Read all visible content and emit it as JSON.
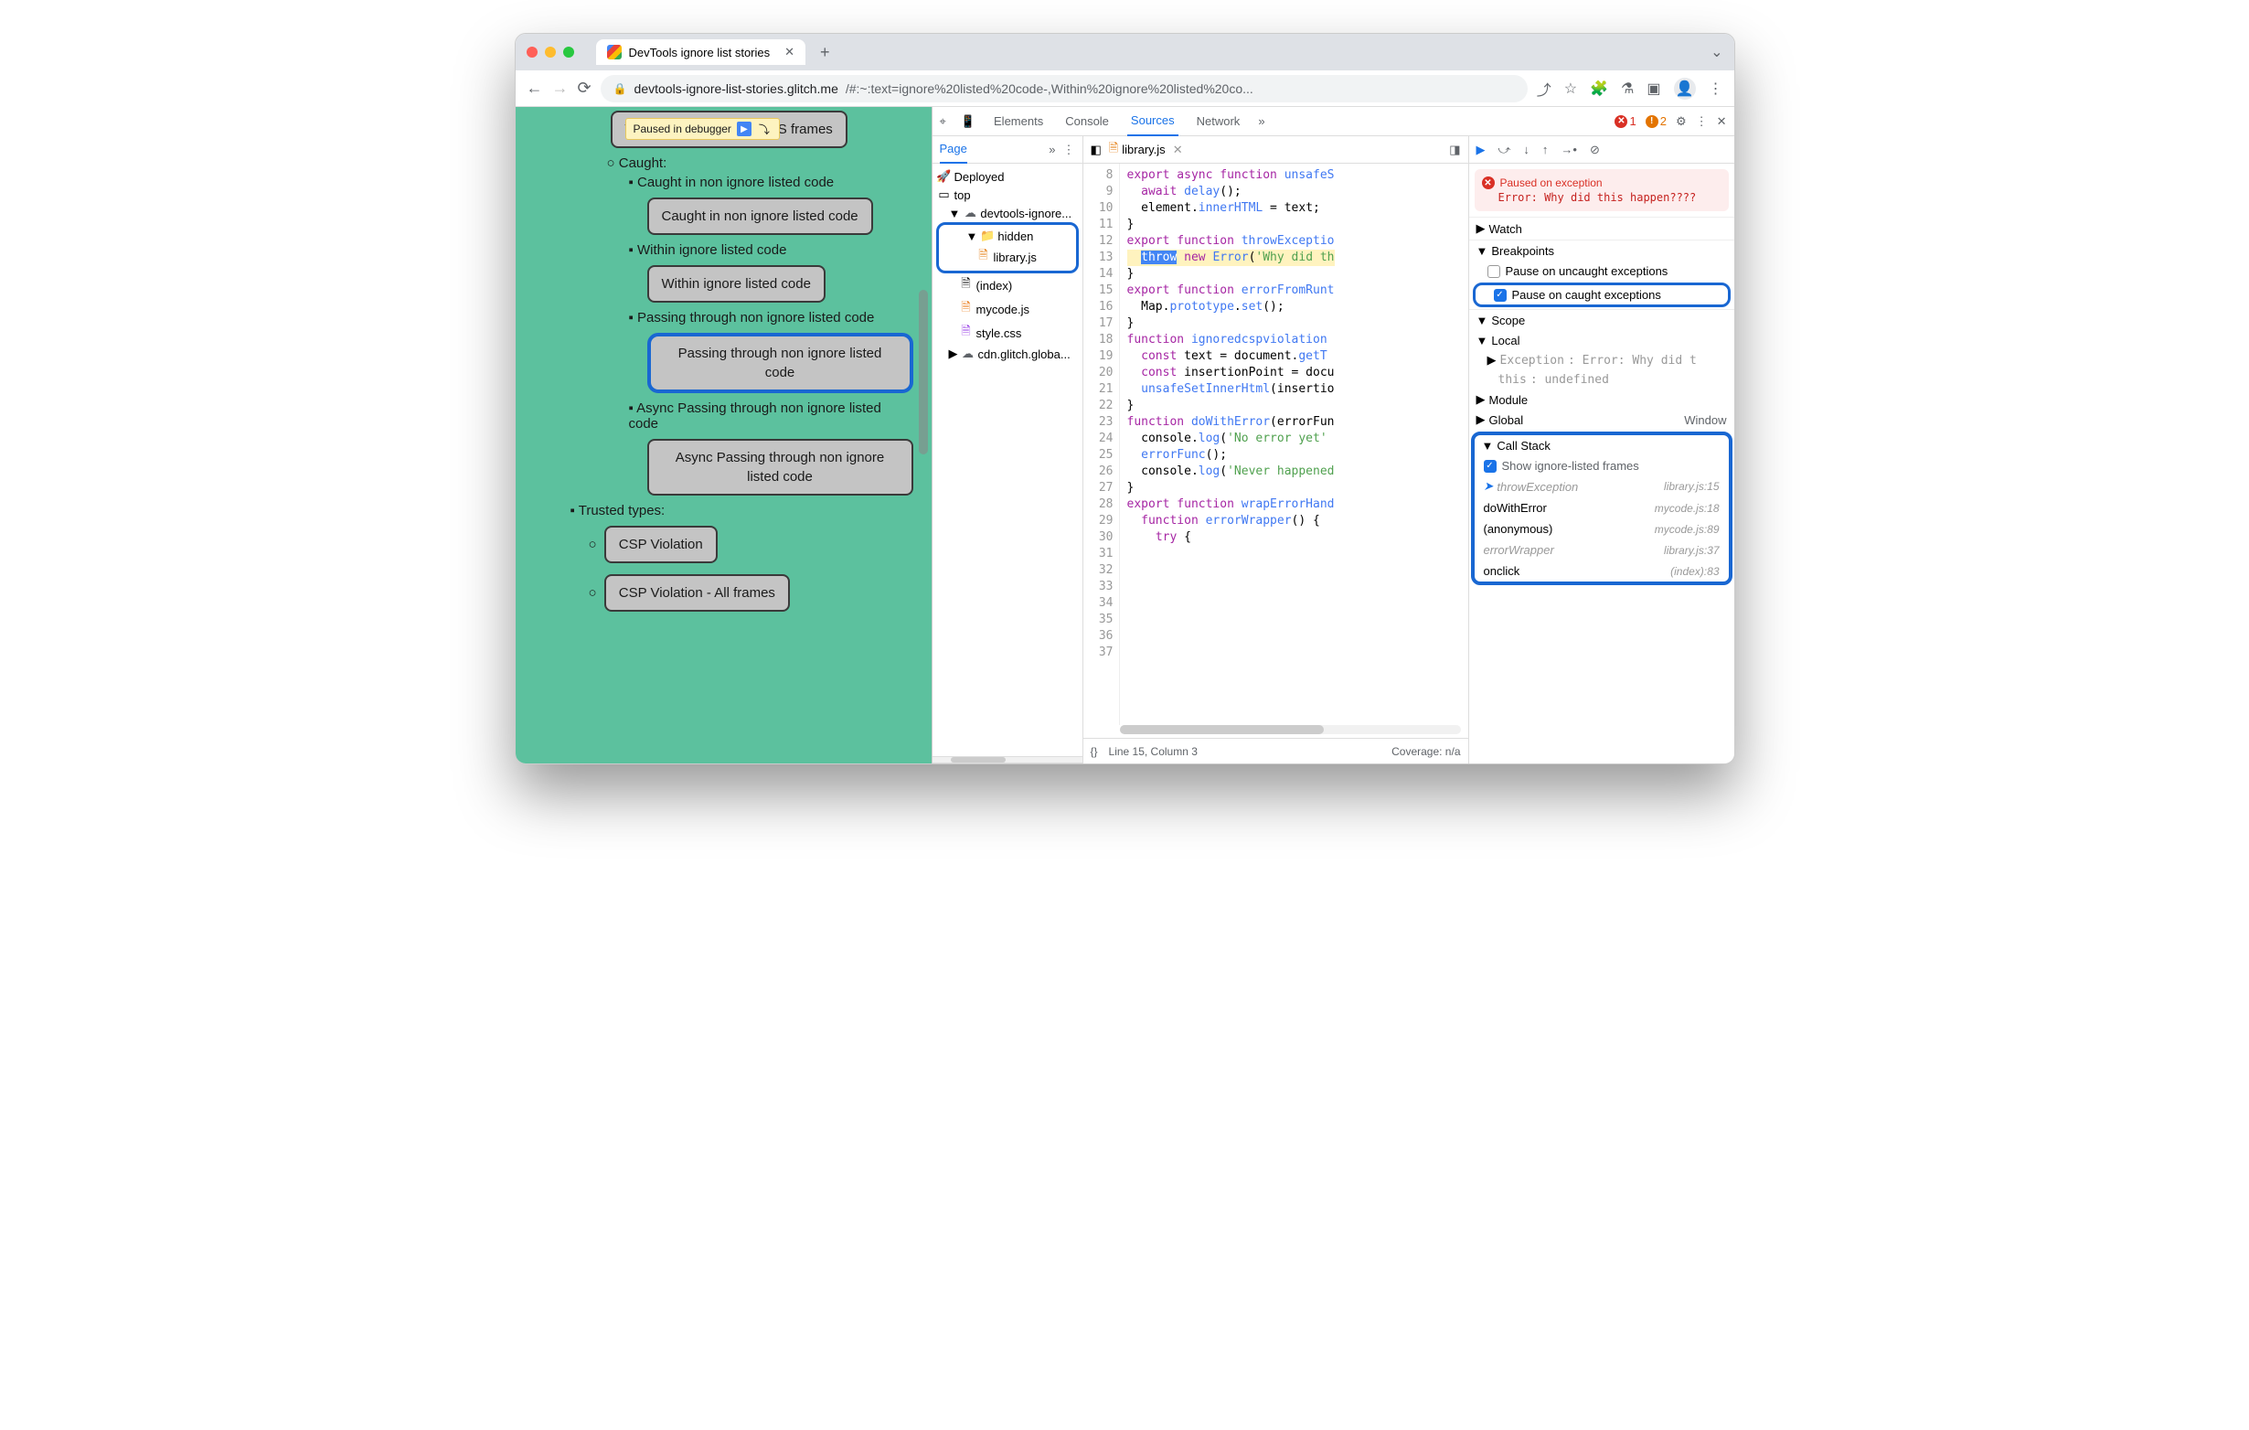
{
  "tab": {
    "title": "DevTools ignore list stories"
  },
  "url": {
    "host": "devtools-ignore-list-stories.glitch.me",
    "path": "/#:~:text=ignore%20listed%20code-,Within%20ignore%20listed%20co..."
  },
  "paused_overlay": "Paused in debugger",
  "page_items": {
    "btn_wasm": "WebAssembly trap - no JS frames",
    "caught_hdr": "Caught:",
    "item_caught": "Caught in non ignore listed code",
    "btn_caught": "Caught in non ignore listed code",
    "item_within": "Within ignore listed code",
    "btn_within": "Within ignore listed code",
    "item_pass": "Passing through non ignore listed code",
    "btn_pass": "Passing through non ignore listed code",
    "item_async": "Async Passing through non ignore listed code",
    "btn_async": "Async Passing through non ignore listed code",
    "trusted_hdr": "Trusted types:",
    "btn_csp1": "CSP Violation",
    "btn_csp2": "CSP Violation - All frames"
  },
  "dt": {
    "tabs": {
      "elements": "Elements",
      "console": "Console",
      "sources": "Sources",
      "network": "Network"
    },
    "errors": "1",
    "warnings": "2",
    "nav": {
      "page": "Page",
      "deployed": "Deployed",
      "top": "top",
      "origin": "devtools-ignore...",
      "hidden": "hidden",
      "library": "library.js",
      "index": "(index)",
      "mycode": "mycode.js",
      "style": "style.css",
      "cdn": "cdn.glitch.globa..."
    },
    "editor": {
      "file": "library.js"
    },
    "status": {
      "line": "Line 15, Column 3",
      "coverage": "Coverage: n/a"
    },
    "lines": [
      "8",
      "9",
      "10",
      "11",
      "12",
      "13",
      "14",
      "15",
      "16",
      "17",
      "18",
      "19",
      "20",
      "21",
      "22",
      "23",
      "24",
      "25",
      "26",
      "27",
      "28",
      "29",
      "30",
      "31",
      "32",
      "33",
      "34",
      "35",
      "36",
      "37"
    ],
    "code": {
      "l8": [
        "export ",
        "async function ",
        "unsafeS"
      ],
      "l9": [
        "  ",
        "await ",
        "delay",
        "();"
      ],
      "l10": [
        "  element.",
        "innerHTML",
        " = text;"
      ],
      "l11": [
        "}"
      ],
      "l12": [
        ""
      ],
      "l13": [
        ""
      ],
      "l14": [
        "export function ",
        "throwExceptio"
      ],
      "l15": [
        "  ",
        "throw",
        " ",
        "new ",
        "Error",
        "(",
        "'Why did th"
      ],
      "l16": [
        "}"
      ],
      "l17": [
        ""
      ],
      "l18": [
        "export function ",
        "errorFromRunt"
      ],
      "l19": [
        "  Map.",
        "prototype",
        ".",
        "set",
        "();"
      ],
      "l20": [
        "}"
      ],
      "l21": [
        ""
      ],
      "l22": [
        "function ",
        "ignoredcspviolation"
      ],
      "l23": [
        "  ",
        "const ",
        "text = document.",
        "getT"
      ],
      "l24": [
        "  ",
        "const ",
        "insertionPoint = docu"
      ],
      "l25": [
        "  ",
        "unsafeSetInnerHtml",
        "(insertio"
      ],
      "l26": [
        "}"
      ],
      "l27": [
        ""
      ],
      "l28": [
        "function ",
        "doWithError",
        "(errorFun"
      ],
      "l29": [
        "  console.",
        "log",
        "(",
        "'No error yet'"
      ],
      "l30": [
        "  ",
        "errorFunc",
        "();"
      ],
      "l31": [
        "  console.",
        "log",
        "(",
        "'Never happened"
      ],
      "l32": [
        "}"
      ],
      "l33": [
        ""
      ],
      "l34": [
        "export function ",
        "wrapErrorHand"
      ],
      "l35": [
        "  ",
        "function ",
        "errorWrapper",
        "() {"
      ],
      "l36": [
        "    ",
        "try ",
        "{"
      ],
      "l37": [
        ""
      ]
    },
    "pause": {
      "title": "Paused on exception",
      "msg": "Error: Why did this happen????"
    },
    "sections": {
      "watch": "Watch",
      "breakpoints": "Breakpoints",
      "scope": "Scope",
      "callstack": "Call Stack"
    },
    "bp": {
      "uncaught": "Pause on uncaught exceptions",
      "caught": "Pause on caught exceptions"
    },
    "scope": {
      "local": "Local",
      "exception": "Exception",
      "exc_val": ": Error: Why did t",
      "this": "this",
      "this_val": ": undefined",
      "module": "Module",
      "global": "Global",
      "window": "Window"
    },
    "cs": {
      "show": "Show ignore-listed frames",
      "f1": "throwException",
      "l1": "library.js:15",
      "f2": "doWithError",
      "l2": "mycode.js:18",
      "f3": "(anonymous)",
      "l3": "mycode.js:89",
      "f4": "errorWrapper",
      "l4": "library.js:37",
      "f5": "onclick",
      "l5": "(index):83"
    }
  }
}
